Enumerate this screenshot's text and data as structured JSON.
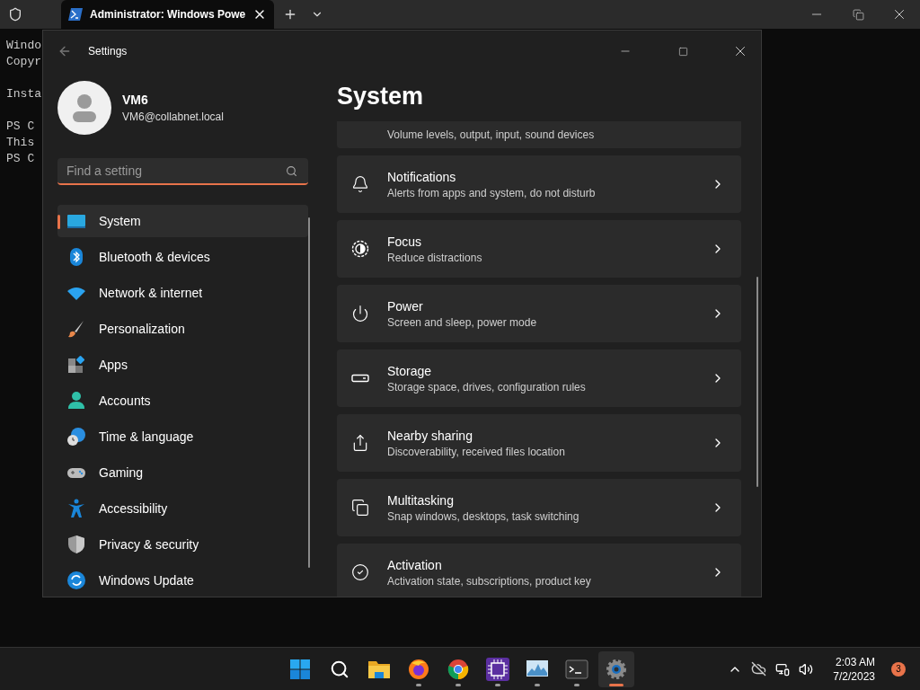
{
  "terminal": {
    "tab_title": "Administrator: Windows Powe",
    "lines": [
      [
        "Windo",
        "Copyr"
      ],
      [
        "Insta"
      ],
      [
        "PS C",
        "This",
        "PS C"
      ]
    ]
  },
  "settings": {
    "title": "Settings",
    "user": {
      "name": "VM6",
      "email": "VM6@collabnet.local"
    },
    "search": {
      "placeholder": "Find a setting"
    },
    "nav": [
      {
        "kind": "system",
        "label": "System",
        "selected": true
      },
      {
        "kind": "bluetooth",
        "label": "Bluetooth & devices",
        "selected": false
      },
      {
        "kind": "network",
        "label": "Network & internet",
        "selected": false
      },
      {
        "kind": "personalization",
        "label": "Personalization",
        "selected": false
      },
      {
        "kind": "apps",
        "label": "Apps",
        "selected": false
      },
      {
        "kind": "accounts",
        "label": "Accounts",
        "selected": false
      },
      {
        "kind": "time",
        "label": "Time & language",
        "selected": false
      },
      {
        "kind": "gaming",
        "label": "Gaming",
        "selected": false
      },
      {
        "kind": "accessibility",
        "label": "Accessibility",
        "selected": false
      },
      {
        "kind": "privacy",
        "label": "Privacy & security",
        "selected": false
      },
      {
        "kind": "update",
        "label": "Windows Update",
        "selected": false
      }
    ],
    "heading": "System",
    "cards": [
      {
        "kind": "sound",
        "subtitle": "Volume levels, output, input, sound devices"
      },
      {
        "kind": "notifications",
        "title": "Notifications",
        "subtitle": "Alerts from apps and system, do not disturb"
      },
      {
        "kind": "focus",
        "title": "Focus",
        "subtitle": "Reduce distractions"
      },
      {
        "kind": "power",
        "title": "Power",
        "subtitle": "Screen and sleep, power mode"
      },
      {
        "kind": "storage",
        "title": "Storage",
        "subtitle": "Storage space, drives, configuration rules"
      },
      {
        "kind": "sharing",
        "title": "Nearby sharing",
        "subtitle": "Discoverability, received files location"
      },
      {
        "kind": "multitasking",
        "title": "Multitasking",
        "subtitle": "Snap windows, desktops, task switching"
      },
      {
        "kind": "activation",
        "title": "Activation",
        "subtitle": "Activation state, subscriptions, product key"
      }
    ]
  },
  "taskbar": {
    "apps": [
      {
        "kind": "start",
        "running": false,
        "selected": false
      },
      {
        "kind": "search",
        "running": false,
        "selected": false
      },
      {
        "kind": "explorer",
        "running": false,
        "selected": false
      },
      {
        "kind": "firefox",
        "running": true,
        "selected": false
      },
      {
        "kind": "chrome",
        "running": true,
        "selected": false
      },
      {
        "kind": "chip",
        "running": true,
        "selected": false
      },
      {
        "kind": "monitor",
        "running": true,
        "selected": false
      },
      {
        "kind": "terminal",
        "running": true,
        "selected": false
      },
      {
        "kind": "settings",
        "running": true,
        "selected": true
      }
    ],
    "time": "2:03 AM",
    "date": "7/2/2023",
    "badge": "3"
  }
}
